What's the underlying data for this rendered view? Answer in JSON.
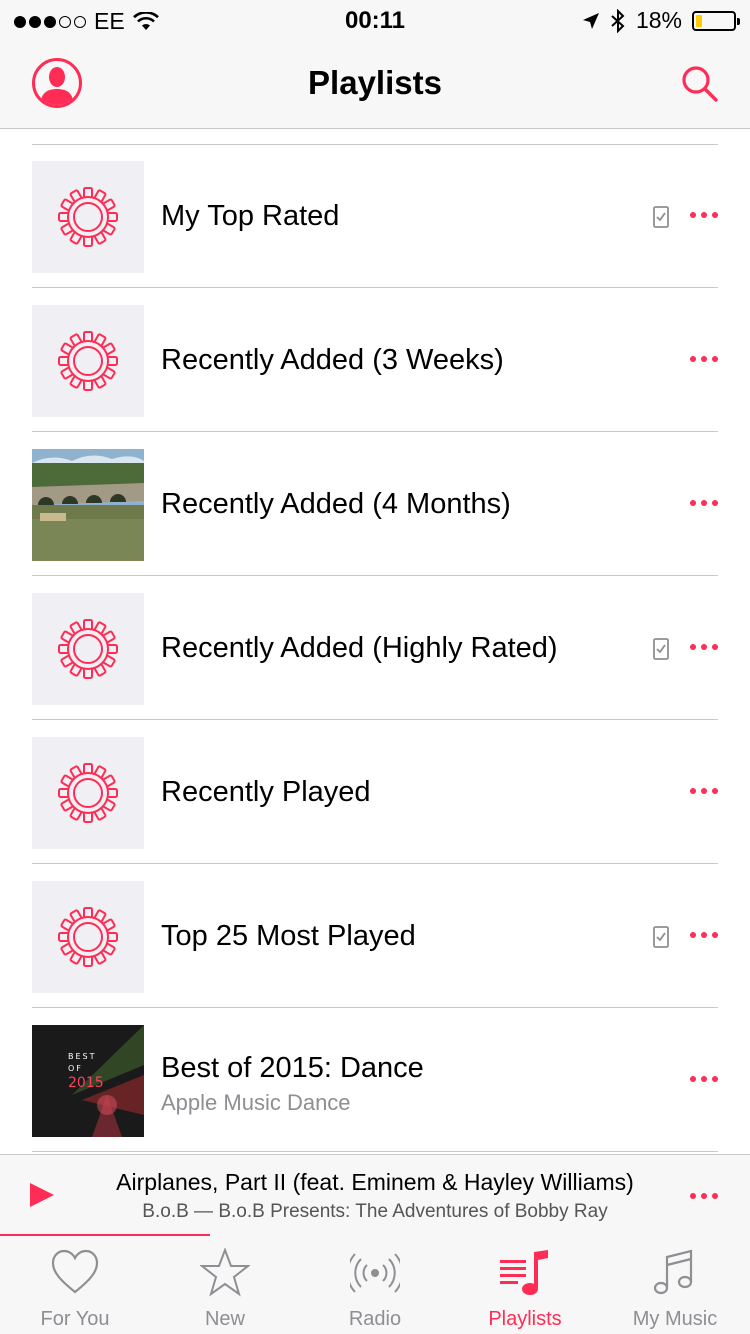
{
  "status_bar": {
    "carrier": "EE",
    "time": "00:11",
    "battery": "18%",
    "battery_level": 0.18,
    "signal_bars": 3
  },
  "nav": {
    "title": "Playlists"
  },
  "playlists": [
    {
      "title": "My Top Rated",
      "subtitle": "",
      "art": "smart-playlist-gear",
      "downloaded": true
    },
    {
      "title": "Recently Added (3 Weeks)",
      "subtitle": "",
      "art": "smart-playlist-gear",
      "downloaded": false
    },
    {
      "title": "Recently Added (4 Months)",
      "subtitle": "",
      "art": "photo-bridge-river",
      "downloaded": false
    },
    {
      "title": "Recently Added (Highly Rated)",
      "subtitle": "",
      "art": "smart-playlist-gear",
      "downloaded": true
    },
    {
      "title": "Recently Played",
      "subtitle": "",
      "art": "smart-playlist-gear",
      "downloaded": false
    },
    {
      "title": "Top 25 Most Played",
      "subtitle": "",
      "art": "smart-playlist-gear",
      "downloaded": true
    },
    {
      "title": "Best of 2015: Dance",
      "subtitle": "Apple Music Dance",
      "art": "best-of-2015-cover",
      "downloaded": false,
      "art_text": [
        "BEST",
        "OF",
        "2015"
      ]
    }
  ],
  "now_playing": {
    "title": "Airplanes, Part II (feat. Eminem & Hayley Williams)",
    "subtitle": "B.o.B — B.o.B Presents: The Adventures of Bobby Ray"
  },
  "tabs": [
    {
      "label": "For You",
      "icon": "heart-icon",
      "active": false
    },
    {
      "label": "New",
      "icon": "star-icon",
      "active": false
    },
    {
      "label": "Radio",
      "icon": "radio-icon",
      "active": false
    },
    {
      "label": "Playlists",
      "icon": "playlists-icon",
      "active": true
    },
    {
      "label": "My Music",
      "icon": "music-note-icon",
      "active": false
    }
  ],
  "colors": {
    "accent": "#ff2d55",
    "bar_background": "#f7f7f7",
    "art_background": "#efeff4",
    "separator": "#c8c7cc",
    "secondary_text": "#8e8e93",
    "battery": "#ffcc00"
  }
}
